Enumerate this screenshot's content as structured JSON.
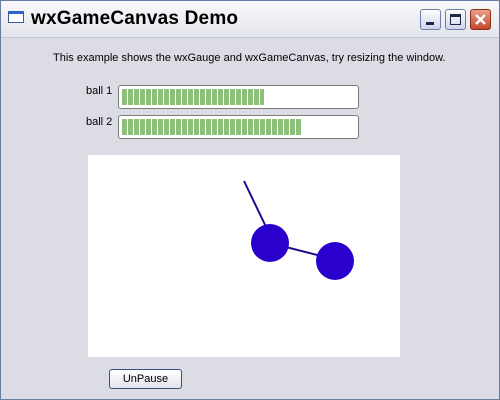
{
  "window": {
    "title": "wxGameCanvas Demo"
  },
  "content": {
    "info_text": "This example shows the wxGauge and wxGameCanvas, try resizing the window."
  },
  "gauges": [
    {
      "label": "ball 1",
      "value_percent": 61
    },
    {
      "label": "ball 2",
      "value_percent": 77
    }
  ],
  "button": {
    "label": "UnPause"
  },
  "colors": {
    "ball": "#2a00cc",
    "rod": "#1e0f8f",
    "gauge_fill": "#8dc07a",
    "canvas_bg": "#ffffff"
  }
}
